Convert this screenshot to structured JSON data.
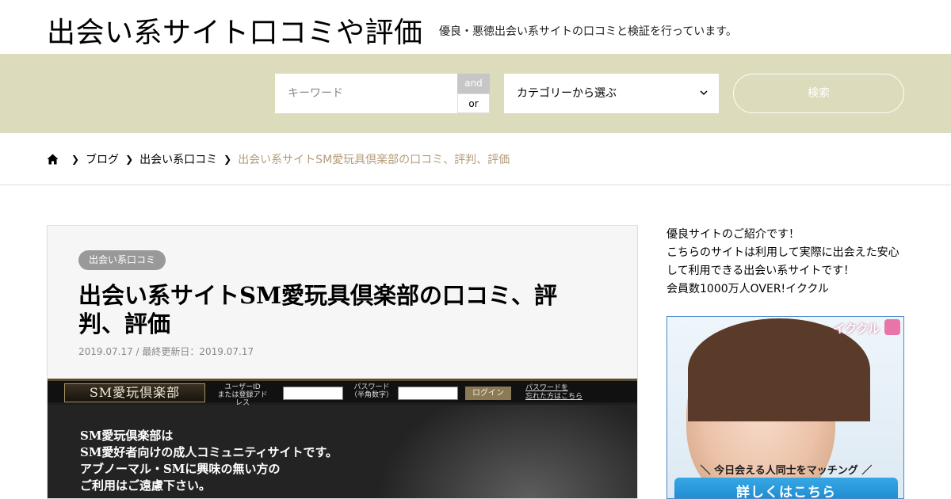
{
  "site": {
    "title": "出会い系サイト口コミや評価",
    "description": "優良・悪徳出会い系サイトの口コミと検証を行っています。"
  },
  "search": {
    "keyword_placeholder": "キーワード",
    "and_label": "and",
    "or_label": "or",
    "category_selected": "カテゴリーから選ぶ",
    "button_label": "検索"
  },
  "breadcrumb": {
    "items": [
      "ブログ",
      "出会い系口コミ"
    ],
    "current": "出会い系サイトSM愛玩具倶楽部の口コミ、評判、評価"
  },
  "article": {
    "category": "出会い系口コミ",
    "title": "出会い系サイトSM愛玩具倶楽部の口コミ、評判、評価",
    "date": "2019.07.17 / 最終更新日：2019.07.17",
    "hero": {
      "logo": "SM愛玩倶楽部",
      "userid_label_1": "ユーザーID",
      "userid_label_2": "または登録アドレス",
      "password_label_1": "パスワード",
      "password_label_2": "（半角数字）",
      "login_button": "ログイン",
      "forgot_1": "パスワードを",
      "forgot_2": "忘れた方はこちら",
      "lines": [
        "SM愛玩倶楽部は",
        "SM愛好者向けの成人コミュニティサイトです。",
        "アブノーマル・SMに興味の無い方の",
        "ご利用はご遠慮下さい。"
      ]
    }
  },
  "sidebar": {
    "intro_lines": [
      "優良サイトのご紹介です！",
      "こちらのサイトは利用して実際に出会えた安心",
      "して利用できる出会い系サイトです！",
      "会員数1000万人OVER!イククル"
    ],
    "ad": {
      "brand": "イククル",
      "tagline": "＼ 今日会える人同士をマッチング ／",
      "cta": "詳しくはこちら"
    }
  },
  "colors": {
    "search_band": "#dcdbbb",
    "breadcrumb_current": "#b39b77",
    "badge": "#999999"
  }
}
